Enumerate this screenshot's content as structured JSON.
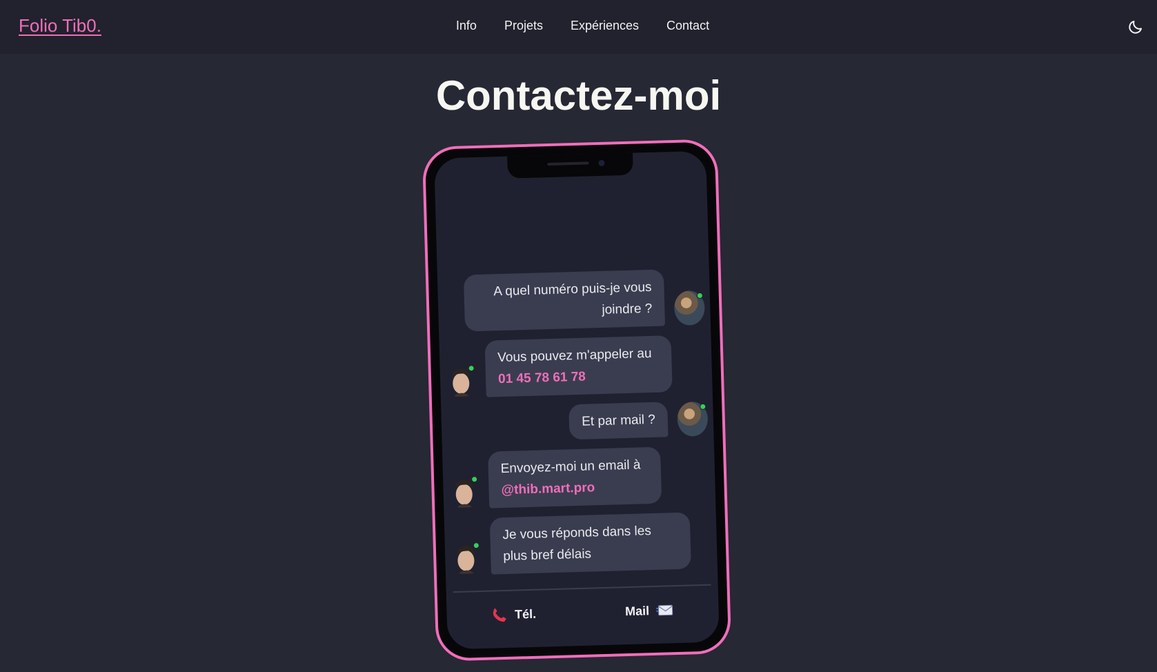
{
  "header": {
    "brand": "Folio Tib0.",
    "nav": [
      "Info",
      "Projets",
      "Expériences",
      "Contact"
    ],
    "theme_toggle_icon": "moon-icon"
  },
  "page": {
    "title": "Contactez-moi"
  },
  "colors": {
    "accent": "#f06eba",
    "background": "#262834",
    "bubble": "#3a3d50",
    "online": "#35d05a"
  },
  "chat": {
    "messages": [
      {
        "side": "right",
        "text": "A quel numéro puis-je vous joindre ?"
      },
      {
        "side": "left",
        "text": "Vous pouvez m'appeler au",
        "highlight": "01 45 78 61 78"
      },
      {
        "side": "right",
        "text": "Et par mail ?"
      },
      {
        "side": "left",
        "text": "Envoyez-moi un email à",
        "highlight": "@thib.mart.pro"
      },
      {
        "side": "left",
        "text": "Je vous réponds dans les plus bref délais"
      }
    ]
  },
  "actions": {
    "phone_label": "Tél.",
    "phone_icon": "phone-icon",
    "mail_label": "Mail",
    "mail_icon": "envelope-icon"
  }
}
